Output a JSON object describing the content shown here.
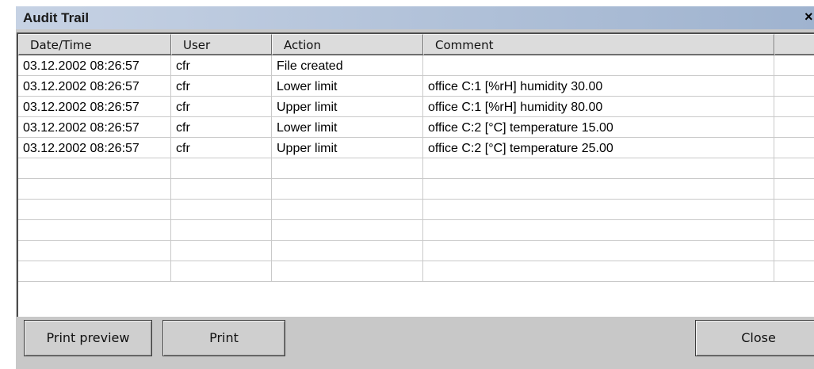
{
  "window": {
    "title": "Audit Trail",
    "close_glyph": "×"
  },
  "table": {
    "columns": [
      "Date/Time",
      "User",
      "Action",
      "Comment",
      ""
    ],
    "rows": [
      [
        "03.12.2002 08:26:57",
        "cfr",
        "File created",
        ""
      ],
      [
        "03.12.2002 08:26:57",
        "cfr",
        "Lower limit",
        "office C:1 [%rH] humidity 30.00"
      ],
      [
        "03.12.2002 08:26:57",
        "cfr",
        "Upper limit",
        "office C:1 [%rH] humidity 80.00"
      ],
      [
        "03.12.2002 08:26:57",
        "cfr",
        "Lower limit",
        "office C:2 [°C] temperature 15.00"
      ],
      [
        "03.12.2002 08:26:57",
        "cfr",
        "Upper limit",
        "office C:2 [°C] temperature 25.00"
      ],
      [
        "",
        "",
        "",
        ""
      ],
      [
        "",
        "",
        "",
        ""
      ],
      [
        "",
        "",
        "",
        ""
      ],
      [
        "",
        "",
        "",
        ""
      ],
      [
        "",
        "",
        "",
        ""
      ],
      [
        "",
        "",
        "",
        ""
      ]
    ]
  },
  "buttons": {
    "print_preview": "Print preview",
    "print": "Print",
    "close": "Close"
  }
}
